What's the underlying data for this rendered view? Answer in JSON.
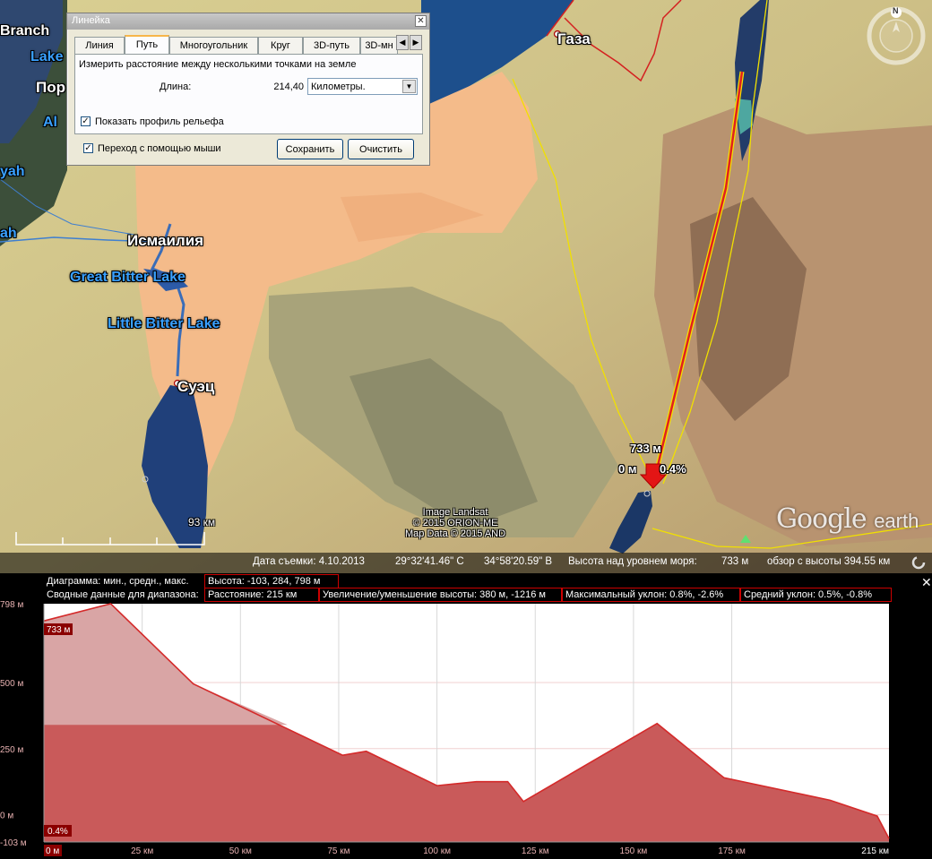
{
  "map": {
    "labels": {
      "gaza": "Газа",
      "ismailia": "Исмаилия",
      "great_bitter_lake": "Great Bitter Lake",
      "little_bitter_lake": "Little Bitter Lake",
      "suez": "Суэц",
      "branch": "Branch",
      "lake": "Lake",
      "port": "Пор",
      "al": "Al",
      "yah": "yah",
      "ah": "ah"
    },
    "measure": {
      "elevation": "733 м",
      "distance": "0 м",
      "slope": "0.4%"
    },
    "scale_label": "93 км",
    "credits": [
      "Image Landsat",
      "© 2015 ORION-ME",
      "Map Data © 2015 AND"
    ],
    "google_logo": {
      "google": "Google",
      "earth": "earth"
    },
    "compass_n": "N",
    "status": {
      "date": "Дата съемки: 4.10.2013",
      "lat": "29°32'41.46\" С",
      "lon": "34°58'20.59\" В",
      "alt_label": "Высота над уровнем моря:",
      "alt_value": "733 м",
      "eye": "обзор с высоты 394.55 км"
    }
  },
  "ruler": {
    "title": "Линейка",
    "tabs": [
      "Линия",
      "Путь",
      "Многоугольник",
      "Круг",
      "3D-путь",
      "3D-мн"
    ],
    "active_tab": "Путь",
    "description": "Измерить расстояние между несколькими точками на земле",
    "length_label": "Длина:",
    "length_value": "214,40",
    "units": "Километры.",
    "show_profile": "Показать профиль рельефа",
    "mouse_nav": "Переход с помощью мыши",
    "save_button": "Сохранить",
    "clear_button": "Очистить"
  },
  "profile": {
    "row1_label": "Диаграмма: мин., средн., макс.",
    "row1_value": "Высота: -103, 284, 798 м",
    "row2_label": "Сводные данные для диапазона:",
    "row2_items": [
      "Расстояние: 215 км",
      "Увеличение/уменьшение высоты: 380 м, -1216 м",
      "Максимальный уклон: 0.8%, -2.6%",
      "Средний уклон: 0.5%, -0.8%"
    ],
    "cursor_elev": "733 м",
    "cursor_slope": "0.4%",
    "cursor_dist": "0 м"
  },
  "chart_data": {
    "type": "area",
    "x_unit": "км",
    "y_unit": "м",
    "xlim": [
      0,
      215
    ],
    "ylim": [
      -103,
      798
    ],
    "x_ticks": [
      25,
      50,
      75,
      100,
      125,
      150,
      175
    ],
    "x_tick_labels": [
      "25 км",
      "50 км",
      "75 км",
      "100 км",
      "125 км",
      "150 км",
      "175 км"
    ],
    "x_end_label": "215 км",
    "y_ticks": [
      -103,
      0,
      250,
      500,
      798
    ],
    "y_tick_labels": [
      "-103 м",
      "0 м",
      "250 м",
      "500 м",
      "798 м"
    ],
    "x": [
      0,
      17,
      38,
      76,
      82,
      100,
      110,
      118,
      122,
      156,
      173,
      200,
      212,
      215
    ],
    "y": [
      733,
      798,
      495,
      225,
      240,
      110,
      125,
      125,
      50,
      345,
      140,
      55,
      -5,
      -90
    ],
    "colors": {
      "fill": "#c95a5a",
      "line": "#d42a2a",
      "cursor_fill": "#d9a5a5"
    }
  }
}
